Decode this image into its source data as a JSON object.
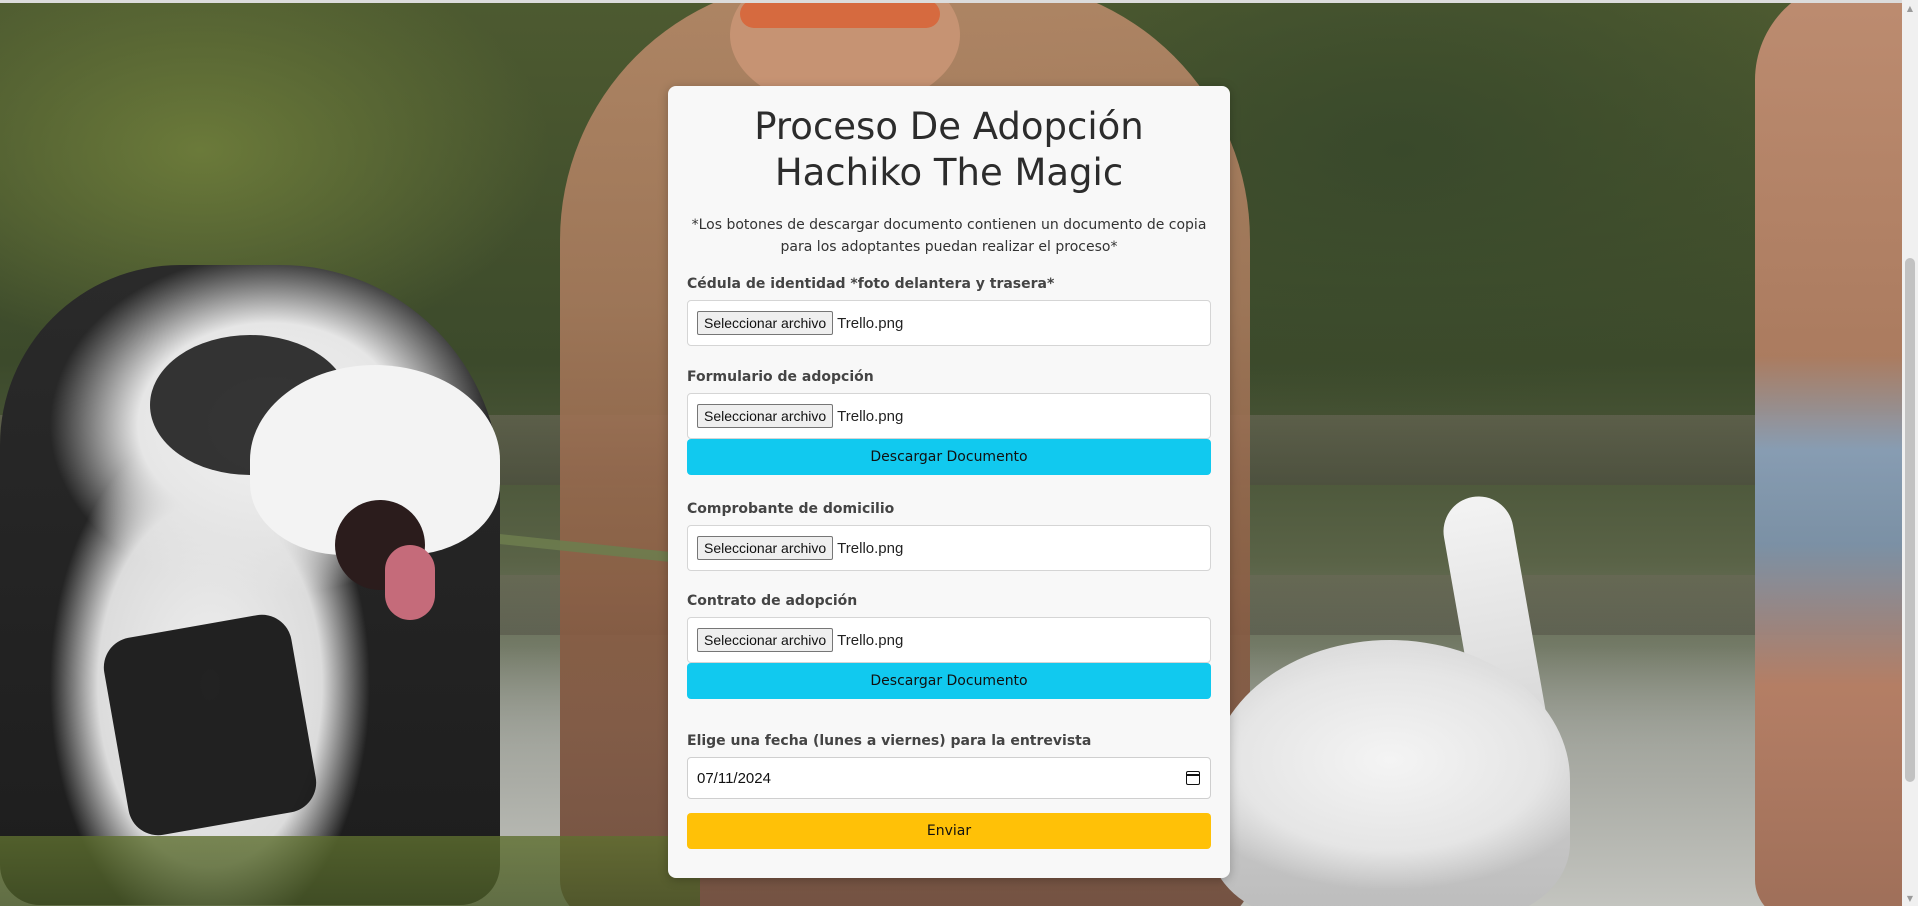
{
  "form": {
    "title": "Proceso De Adopción Hachiko The Magic",
    "note": "*Los botones de descargar documento contienen un documento de copia para los adoptantes puedan realizar el proceso*",
    "file_button_label": "Seleccionar archivo",
    "fields": [
      {
        "label": "Cédula de identidad *foto delantera y trasera*",
        "file": "Trello.png"
      },
      {
        "label": "Formulario de adopción",
        "file": "Trello.png",
        "download": "Descargar Documento"
      },
      {
        "label": "Comprobante de domicilio",
        "file": "Trello.png"
      },
      {
        "label": "Contrato de adopción",
        "file": "Trello.png",
        "download": "Descargar Documento"
      }
    ],
    "date_label": "Elige una fecha (lunes a viernes) para la entrevista",
    "date_value": "07/11/2024",
    "submit_label": "Enviar"
  },
  "icons": {
    "date": "calendar-icon"
  },
  "colors": {
    "download": "#11c9ef",
    "submit": "#ffc107",
    "card": "#f8f8f8"
  }
}
